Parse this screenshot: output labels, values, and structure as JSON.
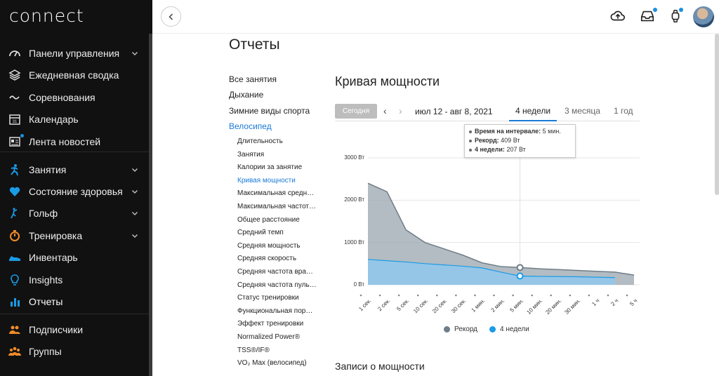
{
  "app": {
    "logo": "connect"
  },
  "sidebar": {
    "items": [
      {
        "label": "Панели управления",
        "icon": "dashboard-icon",
        "chevron": true
      },
      {
        "label": "Ежедневная сводка",
        "icon": "layers-icon",
        "chevron": false
      },
      {
        "label": "Соревнования",
        "icon": "wave-icon",
        "chevron": false
      },
      {
        "label": "Календарь",
        "icon": "calendar-icon",
        "chevron": false,
        "icon_text": "31"
      },
      {
        "label": "Лента новостей",
        "icon": "newsfeed-icon",
        "chevron": false
      },
      {
        "label": "Занятия",
        "icon": "running-person-icon",
        "chevron": true
      },
      {
        "label": "Состояние здоровья",
        "icon": "heart-icon",
        "chevron": true
      },
      {
        "label": "Гольф",
        "icon": "golf-icon",
        "chevron": true
      },
      {
        "label": "Тренировка",
        "icon": "stopwatch-icon",
        "chevron": true
      },
      {
        "label": "Инвентарь",
        "icon": "shoe-icon",
        "chevron": false
      },
      {
        "label": "Insights",
        "icon": "lightbulb-icon",
        "chevron": false
      },
      {
        "label": "Отчеты",
        "icon": "bar-chart-icon",
        "chevron": false
      },
      {
        "label": "Подписчики",
        "icon": "followers-icon",
        "chevron": false
      },
      {
        "label": "Группы",
        "icon": "groups-icon",
        "chevron": false
      }
    ]
  },
  "topbar": {
    "icons": [
      "back-arrow-icon",
      "cloud-upload-icon",
      "inbox-icon",
      "watch-icon",
      "avatar"
    ]
  },
  "page": {
    "title": "Отчеты",
    "categories": [
      {
        "label": "Все занятия"
      },
      {
        "label": "Дыхание"
      },
      {
        "label": "Зимние виды спорта"
      },
      {
        "label": "Велосипед"
      }
    ],
    "subcategories": [
      "Длительность",
      "Занятия",
      "Калории за занятие",
      "Кривая мощности",
      "Максимальная средн…",
      "Максимальная частот…",
      "Общее расстояние",
      "Средний темп",
      "Средняя мощность",
      "Средняя скорость",
      "Средняя частота вра…",
      "Средняя частота пуль…",
      "Статус тренировки",
      "Функциональная пор…",
      "Эффект тренировки",
      "Normalized Power®",
      "TSS®/IF®",
      "VO₂ Max (велосипед)"
    ]
  },
  "report": {
    "title": "Кривая мощности",
    "today_label": "Сегодня",
    "date_range": "июл 12 - авг 8, 2021",
    "tabs": [
      "4 недели",
      "3 месяца",
      "1 год"
    ],
    "tooltip": {
      "interval_label": "Время на интервале:",
      "interval_value": "5 мин.",
      "record_label": "Рекорд:",
      "record_value": "409 Вт",
      "weeks_label": "4 недели:",
      "weeks_value": "207 Вт"
    },
    "records_title": "Записи о мощности"
  },
  "chart_data": {
    "type": "area",
    "x": [
      "1 сек.",
      "2 сек.",
      "5 сек.",
      "10 сек.",
      "20 сек.",
      "30 сек.",
      "1 мин.",
      "2 мин.",
      "5 мин.",
      "10 мин.",
      "20 мин.",
      "30 мин.",
      "1 ч",
      "2 ч",
      "5 ч"
    ],
    "yticks": [
      "0 Вт",
      "1000 Вт",
      "2000 Вт",
      "3000 Вт"
    ],
    "ylim": [
      0,
      3000
    ],
    "series": [
      {
        "name": "Рекорд",
        "color": "#9aa5ae",
        "values": [
          2400,
          2200,
          1300,
          1000,
          850,
          700,
          520,
          430,
          409,
          380,
          360,
          340,
          320,
          300,
          230
        ]
      },
      {
        "name": "4 недели",
        "color": "#8fc8ee",
        "values": [
          600,
          570,
          540,
          500,
          470,
          440,
          400,
          300,
          207,
          200,
          195,
          190,
          180,
          170,
          null
        ]
      }
    ],
    "highlight_index": 8,
    "legend_position": "bottom"
  }
}
